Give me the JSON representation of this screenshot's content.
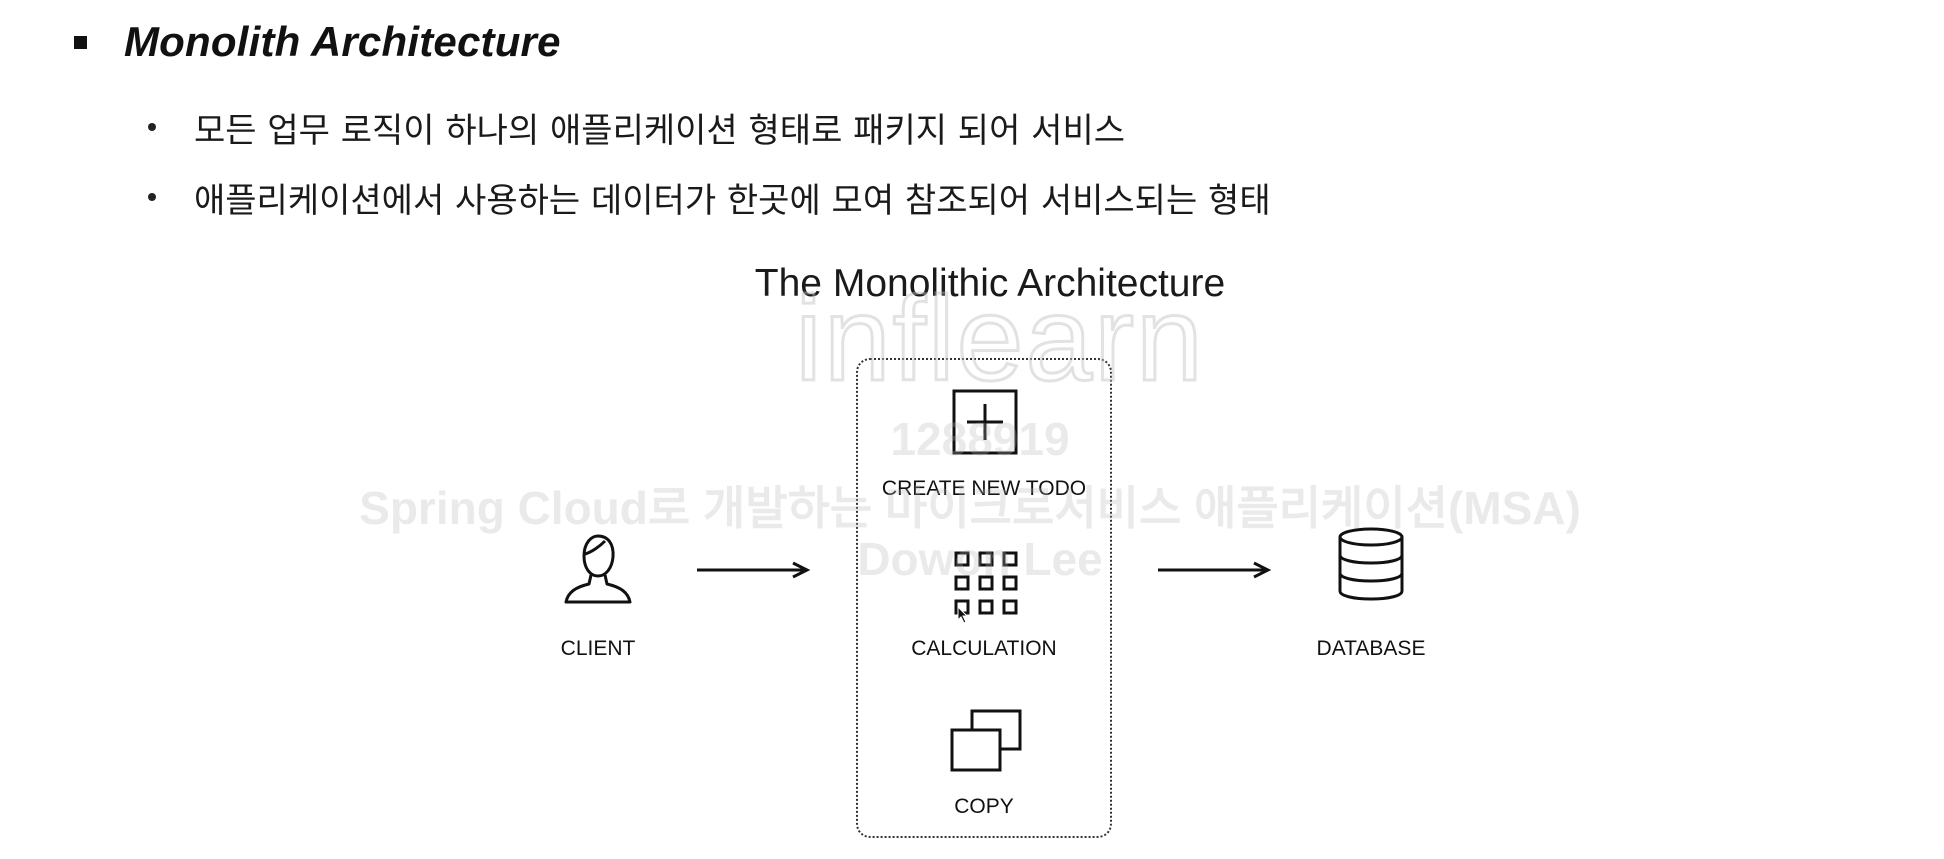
{
  "heading": "Monolith Architecture",
  "bullets": [
    "모든 업무 로직이 하나의 애플리케이션 형태로 패키지 되어 서비스",
    "애플리케이션에서 사용하는 데이터가 한곳에 모여 참조되어 서비스되는 형태"
  ],
  "diagram": {
    "title": "The Monolithic Architecture",
    "client_label": "CLIENT",
    "modules": [
      {
        "label": "CREATE NEW TODO",
        "icon": "plus-square-icon"
      },
      {
        "label": "CALCULATION",
        "icon": "keypad-grid-icon"
      },
      {
        "label": "COPY",
        "icon": "copy-icon"
      }
    ],
    "database_label": "DATABASE"
  },
  "watermark": {
    "logo": "inflearn",
    "id": "1288919",
    "course": "Spring Cloud로 개발하는 마이크로서비스 애플리케이션(MSA)",
    "author": "Dowon Lee"
  },
  "colors": {
    "text": "#111111",
    "background": "#ffffff",
    "watermark": "#b4b4b4"
  }
}
